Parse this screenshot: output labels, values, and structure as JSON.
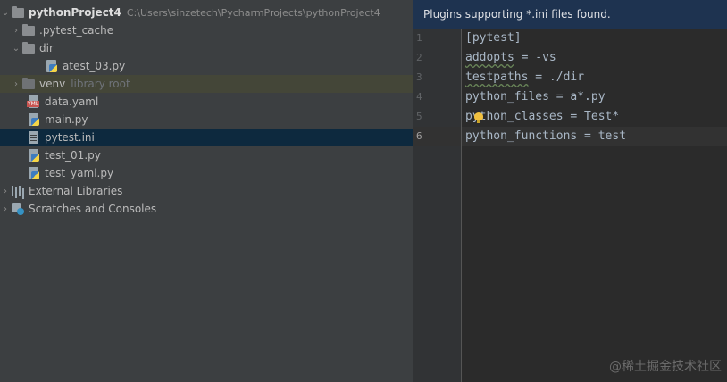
{
  "project_tree": {
    "root": {
      "name": "pythonProject4",
      "path": "C:\\Users\\sinzetech\\PycharmProjects\\pythonProject4"
    },
    "items": [
      {
        "label": ".pytest_cache",
        "hint": ""
      },
      {
        "label": "dir",
        "hint": ""
      },
      {
        "label": "atest_03.py",
        "hint": ""
      },
      {
        "label": "venv",
        "hint": "library root"
      },
      {
        "label": "data.yaml",
        "hint": ""
      },
      {
        "label": "main.py",
        "hint": ""
      },
      {
        "label": "pytest.ini",
        "hint": ""
      },
      {
        "label": "test_01.py",
        "hint": ""
      },
      {
        "label": "test_yaml.py",
        "hint": ""
      },
      {
        "label": "External Libraries",
        "hint": ""
      },
      {
        "label": "Scratches and Consoles",
        "hint": ""
      }
    ]
  },
  "editor": {
    "banner": "Plugins supporting *.ini files found.",
    "line_numbers": [
      "1",
      "2",
      "3",
      "4",
      "5",
      "6"
    ],
    "lines": [
      "[pytest]",
      "addopts = -vs",
      "testpaths = ./dir",
      "python_files = a*.py",
      "python_classes = Test*",
      "python_functions = test"
    ],
    "line2_key": "addopts",
    "line2_rest": " = -vs",
    "line3_key": "testpaths",
    "line3_rest": " = ./dir"
  },
  "watermark": "@稀土掘金技术社区"
}
